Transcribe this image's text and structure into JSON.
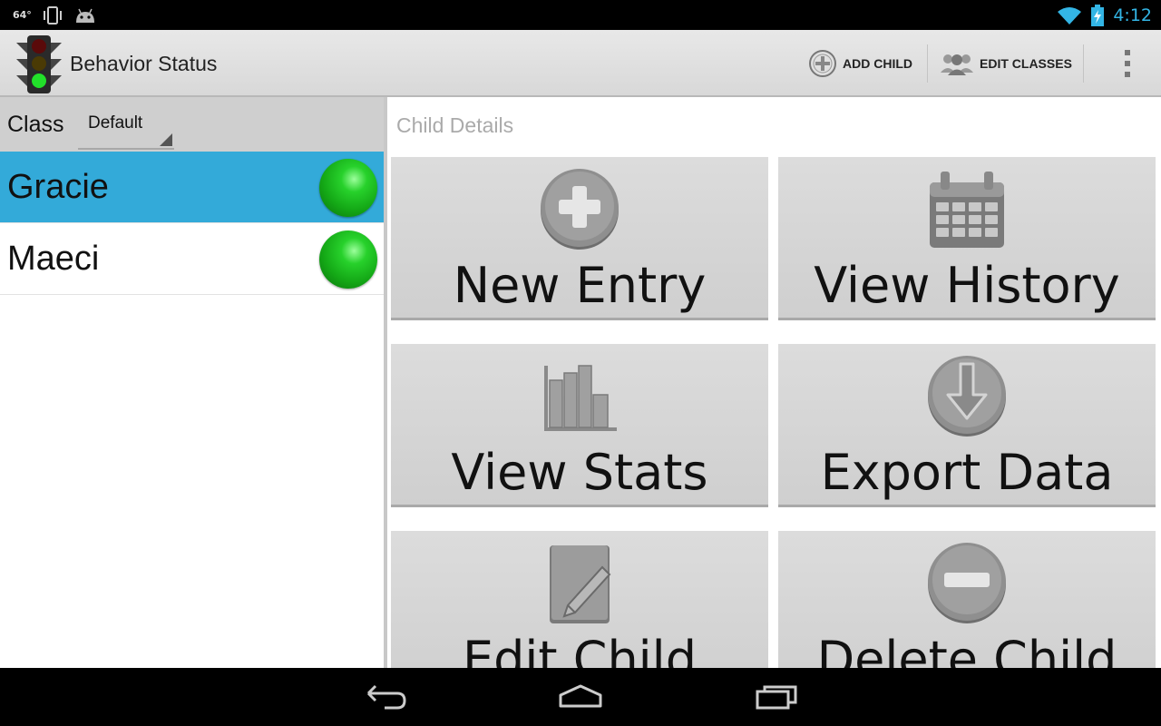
{
  "status_bar": {
    "temperature": "64°",
    "clock": "4:12",
    "icons": [
      "vibrate-icon",
      "android-icon",
      "wifi-icon",
      "battery-charging-icon"
    ]
  },
  "action_bar": {
    "title": "Behavior Status",
    "actions": [
      {
        "label": "ADD CHILD",
        "icon": "add-circle-icon"
      },
      {
        "label": "EDIT CLASSES",
        "icon": "group-icon"
      }
    ],
    "overflow_icon": "overflow-menu-icon"
  },
  "left_pane": {
    "class_label": "Class",
    "class_selected": "Default",
    "children": [
      {
        "name": "Gracie",
        "status": "green",
        "selected": true
      },
      {
        "name": "Maeci",
        "status": "green",
        "selected": false
      }
    ]
  },
  "right_pane": {
    "title": "Child Details",
    "tiles": [
      {
        "label": "New Entry",
        "icon": "plus-circle-icon"
      },
      {
        "label": "View History",
        "icon": "calendar-icon"
      },
      {
        "label": "View Stats",
        "icon": "bar-chart-icon"
      },
      {
        "label": "Export Data",
        "icon": "download-icon"
      },
      {
        "label": "Edit Child",
        "icon": "edit-icon"
      },
      {
        "label": "Delete Child",
        "icon": "minus-circle-icon"
      }
    ]
  },
  "colors": {
    "accent": "#33b5e5",
    "selected_row": "#33aad9",
    "status_green": "#14a816"
  },
  "nav_bar": {
    "buttons": [
      "back-icon",
      "home-icon",
      "recent-apps-icon"
    ]
  }
}
